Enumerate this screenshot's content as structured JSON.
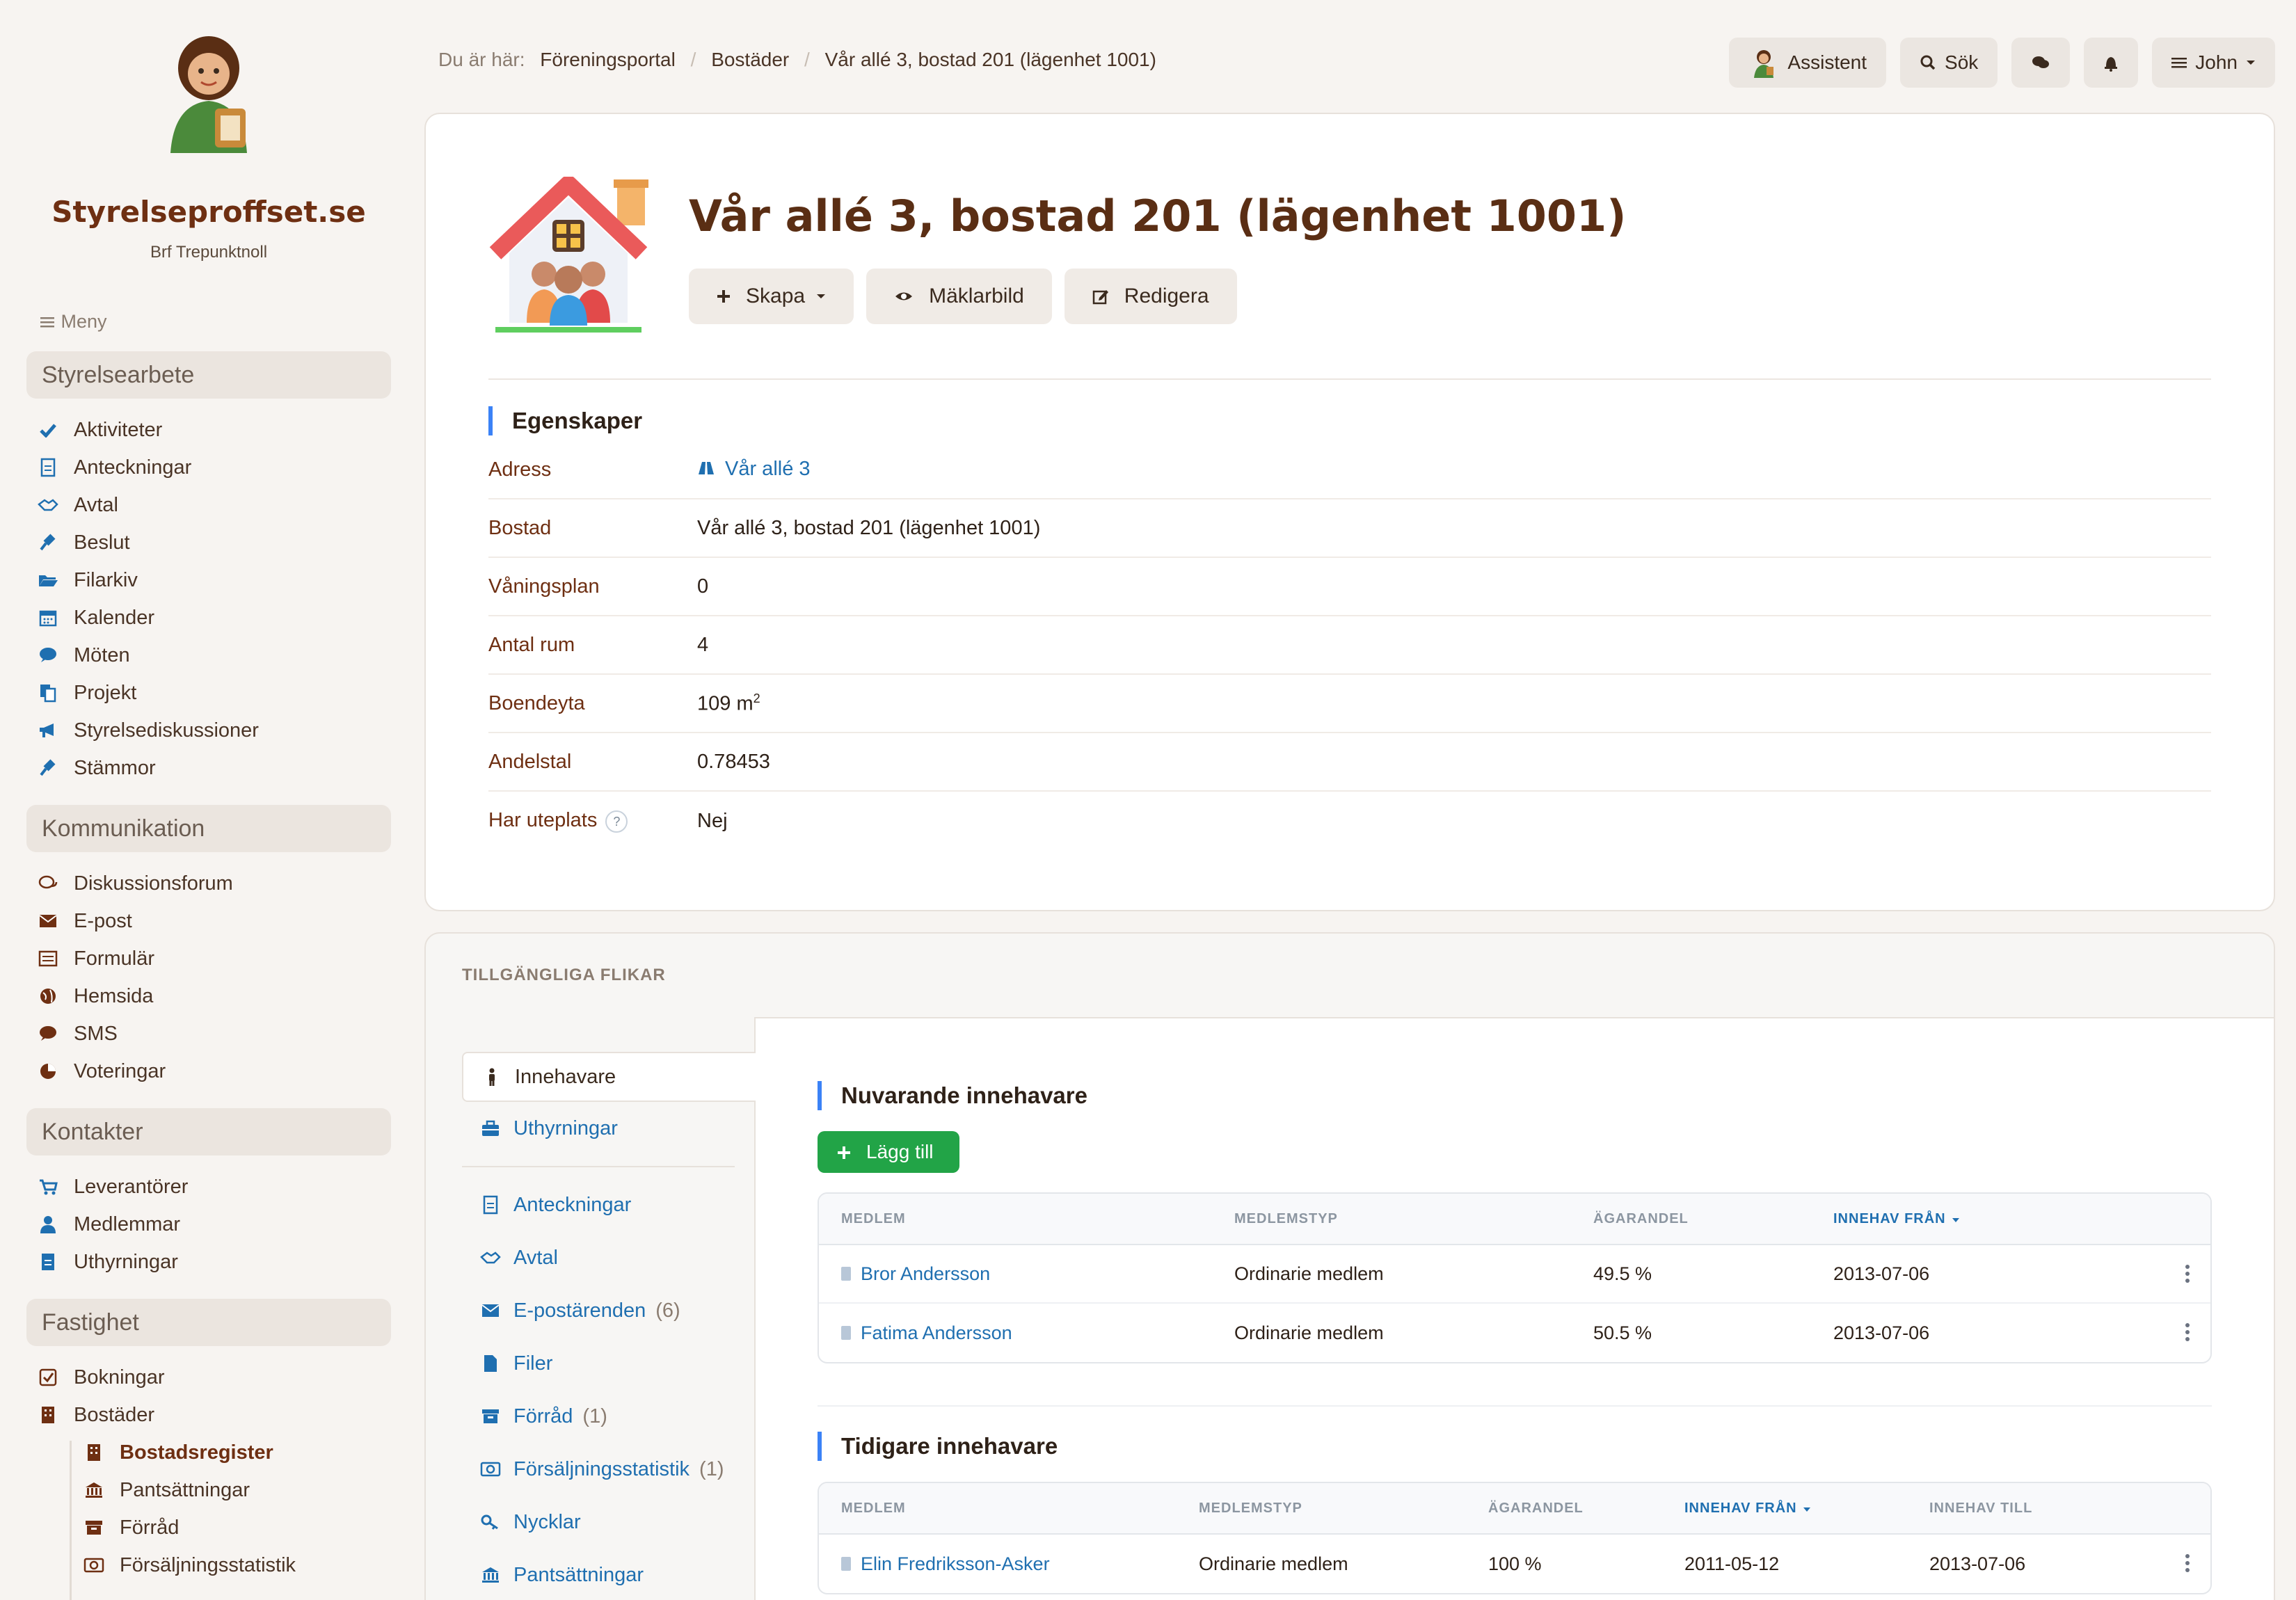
{
  "brand": {
    "name": "Styrelseproffset.se",
    "org": "Brf Trepunktnoll"
  },
  "menu_label": "Meny",
  "sidebar": {
    "sections": [
      {
        "title": "Styrelsearbete",
        "items": [
          {
            "label": "Aktiviteter",
            "icon": "check-icon"
          },
          {
            "label": "Anteckningar",
            "icon": "document-icon"
          },
          {
            "label": "Avtal",
            "icon": "handshake-icon"
          },
          {
            "label": "Beslut",
            "icon": "gavel-icon"
          },
          {
            "label": "Filarkiv",
            "icon": "folder-open-icon"
          },
          {
            "label": "Kalender",
            "icon": "calendar-icon"
          },
          {
            "label": "Möten",
            "icon": "comment-icon"
          },
          {
            "label": "Projekt",
            "icon": "copy-icon"
          },
          {
            "label": "Styrelsediskussioner",
            "icon": "bullhorn-icon"
          },
          {
            "label": "Stämmor",
            "icon": "gavel-icon"
          }
        ]
      },
      {
        "title": "Kommunikation",
        "items": [
          {
            "label": "Diskussionsforum",
            "icon": "comments-icon"
          },
          {
            "label": "E-post",
            "icon": "envelope-icon"
          },
          {
            "label": "Formulär",
            "icon": "form-icon"
          },
          {
            "label": "Hemsida",
            "icon": "globe-icon"
          },
          {
            "label": "SMS",
            "icon": "comment-icon"
          },
          {
            "label": "Voteringar",
            "icon": "pie-chart-icon"
          }
        ]
      },
      {
        "title": "Kontakter",
        "items": [
          {
            "label": "Leverantörer",
            "icon": "cart-icon"
          },
          {
            "label": "Medlemmar",
            "icon": "user-icon"
          },
          {
            "label": "Uthyrningar",
            "icon": "document-icon"
          }
        ]
      },
      {
        "title": "Fastighet",
        "items": [
          {
            "label": "Bokningar",
            "icon": "checkbox-icon"
          },
          {
            "label": "Bostäder",
            "icon": "building-icon"
          }
        ],
        "subitems": [
          {
            "label": "Bostadsregister",
            "icon": "building-icon",
            "active": true
          },
          {
            "label": "Pantsättningar",
            "icon": "bank-icon"
          },
          {
            "label": "Förråd",
            "icon": "archive-icon"
          },
          {
            "label": "Försäljningsstatistik",
            "icon": "money-icon"
          }
        ]
      }
    ]
  },
  "breadcrumb": {
    "prefix": "Du är här:",
    "items": [
      "Föreningsportal",
      "Bostäder",
      "Vår allé 3, bostad 201 (lägenhet 1001)"
    ]
  },
  "topbar": {
    "assistant": "Assistent",
    "search": "Sök",
    "user": "John"
  },
  "page": {
    "title": "Vår allé 3, bostad 201 (lägenhet 1001)",
    "actions": {
      "create": "Skapa",
      "broker": "Mäklarbild",
      "edit": "Redigera"
    }
  },
  "properties": {
    "title": "Egenskaper",
    "rows": [
      {
        "key": "Adress",
        "value": "Vår allé 3"
      },
      {
        "key": "Bostad",
        "value": "Vår allé 3, bostad 201 (lägenhet 1001)"
      },
      {
        "key": "Våningsplan",
        "value": "0"
      },
      {
        "key": "Antal rum",
        "value": "4"
      },
      {
        "key": "Boendeyta",
        "value": "109 m",
        "sup": "2"
      },
      {
        "key": "Andelstal",
        "value": "0.78453"
      },
      {
        "key": "Har uteplats",
        "value": "Nej",
        "help": "?"
      }
    ]
  },
  "tabs_section": {
    "title": "TILLGÄNGLIGA FLIKAR",
    "tabs": [
      {
        "label": "Innehavare",
        "icon": "person-icon",
        "active": true
      },
      {
        "label": "Uthyrningar",
        "icon": "briefcase-icon"
      }
    ],
    "tabs2": [
      {
        "label": "Anteckningar",
        "icon": "document-icon"
      },
      {
        "label": "Avtal",
        "icon": "handshake-icon"
      },
      {
        "label": "E-postärenden",
        "icon": "envelope-icon",
        "count": "(6)"
      },
      {
        "label": "Filer",
        "icon": "file-icon"
      },
      {
        "label": "Förråd",
        "icon": "archive-icon",
        "count": "(1)"
      },
      {
        "label": "Försäljningsstatistik",
        "icon": "money-icon",
        "count": "(1)"
      },
      {
        "label": "Nycklar",
        "icon": "key-icon"
      },
      {
        "label": "Pantsättningar",
        "icon": "bank-icon"
      }
    ]
  },
  "current_owners": {
    "title": "Nuvarande innehavare",
    "add_label": "Lägg till",
    "headers": [
      "MEDLEM",
      "MEDLEMSTYP",
      "ÄGARANDEL",
      "INNEHAV FRÅN"
    ],
    "rows": [
      [
        "Bror Andersson",
        "Ordinarie medlem",
        "49.5 %",
        "2013-07-06"
      ],
      [
        "Fatima Andersson",
        "Ordinarie medlem",
        "50.5 %",
        "2013-07-06"
      ]
    ]
  },
  "previous_owners": {
    "title": "Tidigare innehavare",
    "headers": [
      "MEDLEM",
      "MEDLEMSTYP",
      "ÄGARANDEL",
      "INNEHAV FRÅN",
      "INNEHAV TILL"
    ],
    "rows": [
      [
        "Elin Fredriksson-Asker",
        "Ordinarie medlem",
        "100 %",
        "2011-05-12",
        "2013-07-06"
      ]
    ]
  },
  "colors": {
    "accent": "#3b82f6",
    "brand": "#6e2f12",
    "link": "#1f6fb0",
    "success": "#22a447"
  }
}
